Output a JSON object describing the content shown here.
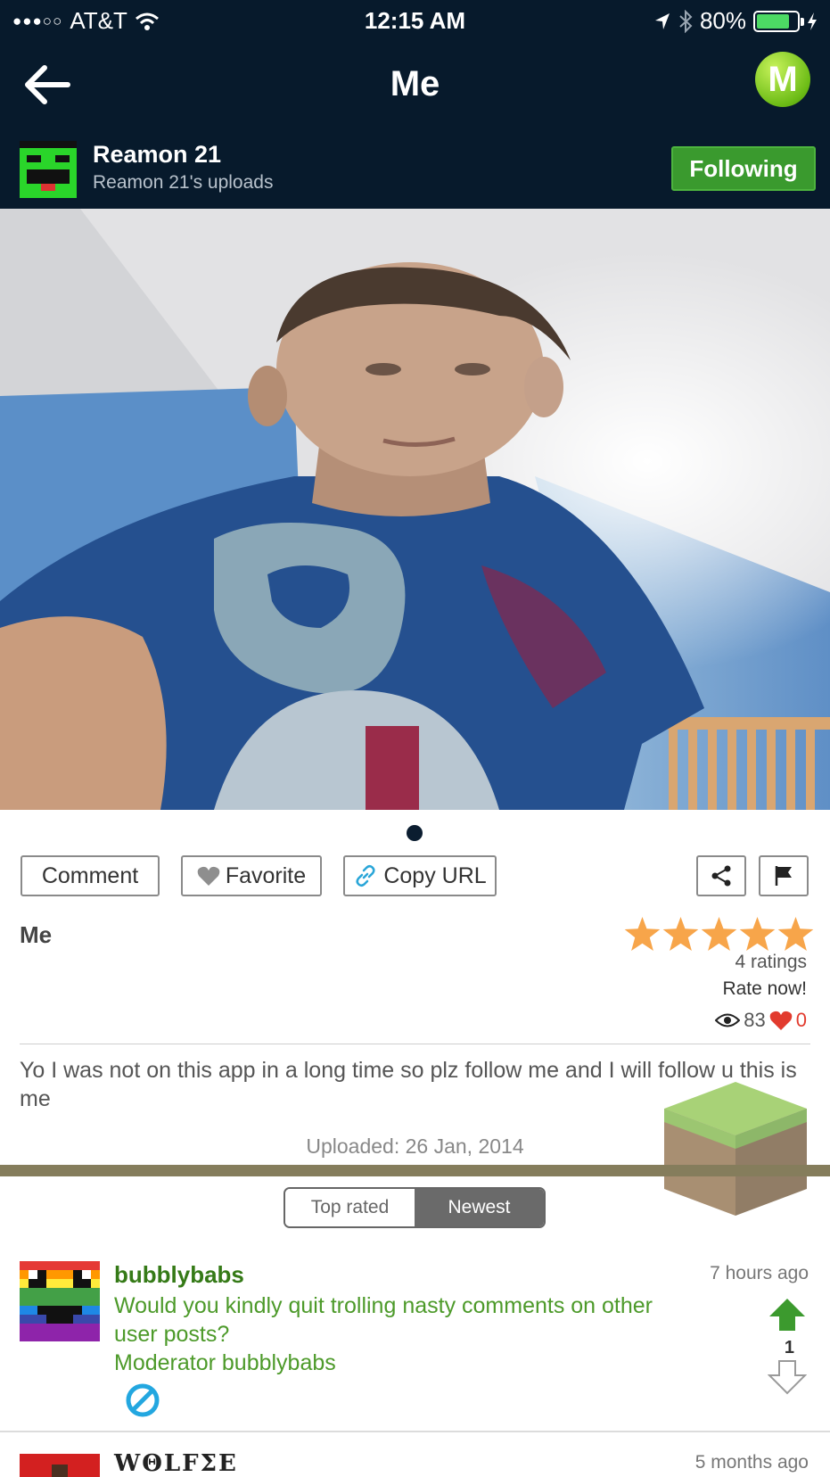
{
  "status_bar": {
    "carrier": "AT&T",
    "time": "12:15 AM",
    "battery": "80%",
    "battery_level": 0.8
  },
  "nav": {
    "title": "Me",
    "logo_letter": "M"
  },
  "profile": {
    "name": "Reamon 21",
    "subtitle": "Reamon 21's uploads",
    "follow_label": "Following"
  },
  "actions": {
    "comment": "Comment",
    "favorite": "Favorite",
    "copy_url": "Copy URL"
  },
  "post": {
    "title": "Me",
    "ratings_count": "4 ratings",
    "rate_now": "Rate now!",
    "stars": 5,
    "views": "83",
    "likes": "0",
    "description": "Yo I was not on this app in a long time so plz follow me and I will follow u this is me",
    "uploaded": "Uploaded: 26 Jan, 2014"
  },
  "sort_tabs": {
    "top_rated": "Top rated",
    "newest": "Newest",
    "selected": "Newest"
  },
  "comments": [
    {
      "user": "bubblybabs",
      "time": "7 hours ago",
      "text": "Would you kindly quit trolling nasty comments on other user posts?\nModerator bubblybabs",
      "votes": "1"
    },
    {
      "user": "WΘLFΣE",
      "time": "5 months ago",
      "text": "",
      "votes": ""
    }
  ],
  "colors": {
    "header_bg": "#071a2c",
    "following_green": "#3a9a2e",
    "comment_green": "#4d9a2a",
    "star_orange": "#f7a54a",
    "olive_bar": "#857d5c"
  }
}
